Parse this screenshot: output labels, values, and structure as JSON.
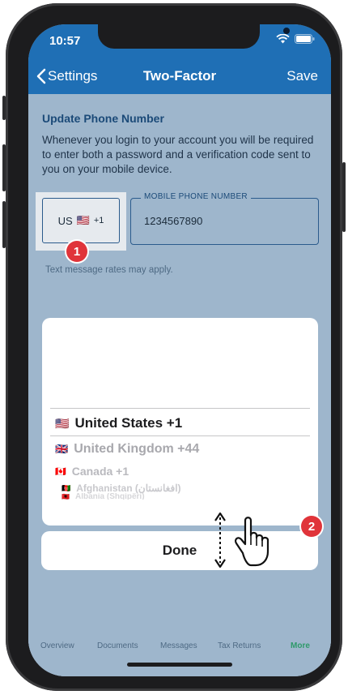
{
  "status_bar": {
    "time": "10:57"
  },
  "nav": {
    "back_label": "Settings",
    "title": "Two-Factor",
    "save_label": "Save"
  },
  "section": {
    "title": "Update Phone Number",
    "description": "Whenever you login to your account you will be required to enter both a password and a verification code sent to you on your mobile device."
  },
  "country_selector": {
    "country": "US",
    "flag": "🇺🇸",
    "code": "+1"
  },
  "phone_field": {
    "label": "MOBILE PHONE NUMBER",
    "value": "1234567890"
  },
  "rates_note": "Text message rates may apply.",
  "picker": {
    "selected": {
      "flag": "🇺🇸",
      "label": "United States +1"
    },
    "items": [
      {
        "flag": "🇬🇧",
        "label": "United Kingdom +44"
      },
      {
        "flag": "🇨🇦",
        "label": "Canada +1"
      },
      {
        "flag": "🇦🇫",
        "label": "Afghanistan (افغانستان)"
      },
      {
        "flag": "🇦🇱",
        "label": "Albania (Shqipëri)"
      }
    ]
  },
  "done_label": "Done",
  "tabs": [
    "Overview",
    "Documents",
    "Messages",
    "Tax Returns",
    "More"
  ],
  "badges": [
    "1",
    "2"
  ],
  "colors": {
    "nav_blue": "#1f6fb5",
    "overlay": "#9eb6cc",
    "badge_red": "#e0343a",
    "active_tab": "#2e9a6a"
  }
}
